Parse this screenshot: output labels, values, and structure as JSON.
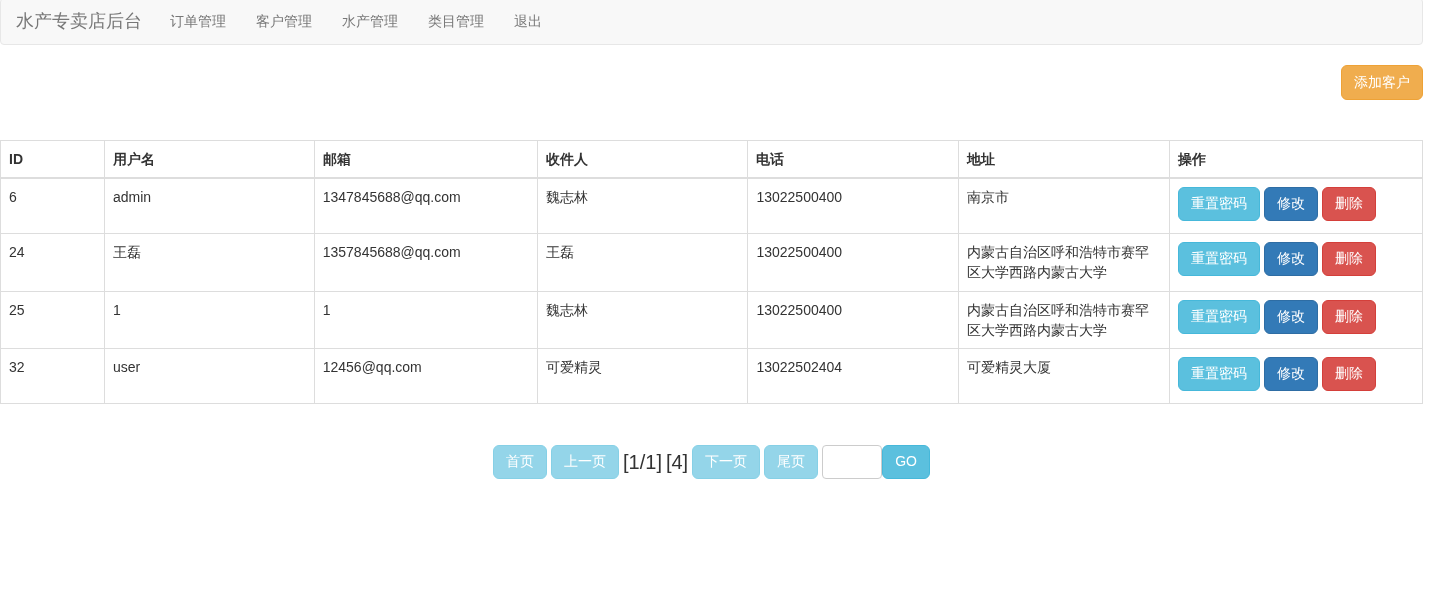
{
  "navbar": {
    "brand": "水产专卖店后台",
    "links": [
      "订单管理",
      "客户管理",
      "水产管理",
      "类目管理",
      "退出"
    ]
  },
  "add_button": "添加客户",
  "table": {
    "columns": [
      "ID",
      "用户名",
      "邮箱",
      "收件人",
      "电话",
      "地址",
      "操作"
    ],
    "rows": [
      {
        "id": "6",
        "username": "admin",
        "email": "1347845688@qq.com",
        "recipient": "魏志林",
        "phone": "13022500400",
        "address": "南京市",
        "actions": [
          "重置密码",
          "修改",
          "删除"
        ]
      },
      {
        "id": "24",
        "username": "王磊",
        "email": "1357845688@qq.com",
        "recipient": "王磊",
        "phone": "13022500400",
        "address": "内蒙古自治区呼和浩特市赛罕区大学西路内蒙古大学",
        "actions": [
          "重置密码",
          "修改",
          "删除"
        ]
      },
      {
        "id": "25",
        "username": "1",
        "email": "1",
        "recipient": "魏志林",
        "phone": "13022500400",
        "address": "内蒙古自治区呼和浩特市赛罕区大学西路内蒙古大学",
        "actions": [
          "重置密码",
          "修改",
          "删除"
        ]
      },
      {
        "id": "32",
        "username": "user",
        "email": "12456@qq.com",
        "recipient": "可爱精灵",
        "phone": "13022502404",
        "address": "可爱精灵大厦",
        "actions": [
          "重置密码",
          "修改",
          "删除"
        ]
      }
    ]
  },
  "pagination": {
    "first": {
      "label": "首页",
      "disabled": true
    },
    "prev": {
      "label": "上一页",
      "disabled": true
    },
    "page_info": "[1/1]",
    "total": "[4]",
    "next": {
      "label": "下一页",
      "disabled": true
    },
    "last": {
      "label": "尾页",
      "disabled": true
    },
    "go": "GO"
  }
}
